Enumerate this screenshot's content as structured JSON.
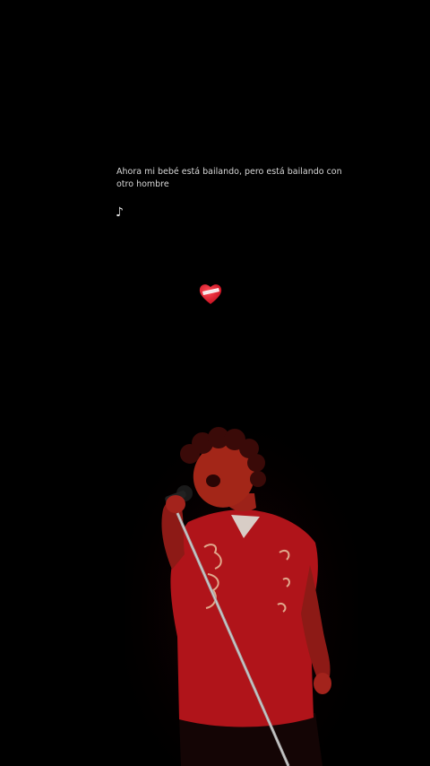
{
  "lyrics": {
    "line": "Ahora mi bebé está bailando, pero está bailando con otro hombre",
    "note_glyph": "♪"
  },
  "decorations": {
    "heart_icon": "mending-heart-icon",
    "heart_color": "#e8162a"
  },
  "photo": {
    "subject": "singer-with-microphone",
    "shirt_color": "#c2161c",
    "lighting": "red stage light"
  }
}
